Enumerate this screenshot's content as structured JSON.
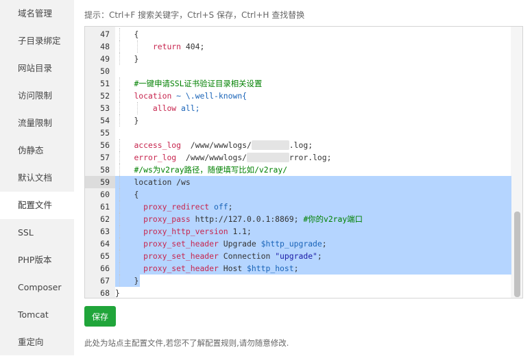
{
  "sidebar": {
    "items": [
      {
        "label": "域名管理"
      },
      {
        "label": "子目录绑定"
      },
      {
        "label": "网站目录"
      },
      {
        "label": "访问限制"
      },
      {
        "label": "流量限制"
      },
      {
        "label": "伪静态"
      },
      {
        "label": "默认文档"
      },
      {
        "label": "配置文件",
        "active": true
      },
      {
        "label": "SSL"
      },
      {
        "label": "PHP版本"
      },
      {
        "label": "Composer"
      },
      {
        "label": "Tomcat"
      },
      {
        "label": "重定向"
      }
    ]
  },
  "hint": "提示：Ctrl+F 搜索关键字，Ctrl+S 保存，Ctrl+H 查找替换",
  "editor": {
    "lines": [
      {
        "num": "47",
        "indent": 1,
        "tokens": [
          {
            "t": "{",
            "c": "txt"
          }
        ]
      },
      {
        "num": "48",
        "indent": 2,
        "tokens": [
          {
            "t": "return",
            "c": "key"
          },
          {
            "t": " 404;",
            "c": "txt"
          }
        ]
      },
      {
        "num": "49",
        "indent": 1,
        "tokens": [
          {
            "t": "}",
            "c": "txt"
          }
        ]
      },
      {
        "num": "50",
        "indent": 0,
        "tokens": []
      },
      {
        "num": "51",
        "indent": 1,
        "tokens": [
          {
            "t": "#一键申请SSL证书验证目录相关设置",
            "c": "com"
          }
        ]
      },
      {
        "num": "52",
        "indent": 1,
        "tokens": [
          {
            "t": "location",
            "c": "key"
          },
          {
            "t": " ~ \\.well-known{",
            "c": "var"
          }
        ]
      },
      {
        "num": "53",
        "indent": 2,
        "tokens": [
          {
            "t": "allow",
            "c": "key"
          },
          {
            "t": " all;",
            "c": "var"
          }
        ]
      },
      {
        "num": "54",
        "indent": 1,
        "tokens": [
          {
            "t": "}",
            "c": "txt"
          }
        ]
      },
      {
        "num": "55",
        "indent": 0,
        "tokens": []
      },
      {
        "num": "56",
        "indent": 1,
        "tokens": [
          {
            "t": "access_log",
            "c": "key"
          },
          {
            "t": "  /www/wwwlogs/",
            "c": "txt"
          },
          {
            "t": "        ",
            "c": "blur"
          },
          {
            "t": ".log;",
            "c": "txt"
          }
        ]
      },
      {
        "num": "57",
        "indent": 1,
        "tokens": [
          {
            "t": "error_log",
            "c": "key"
          },
          {
            "t": "  /www/wwwlogs/",
            "c": "txt"
          },
          {
            "t": "         ",
            "c": "blur"
          },
          {
            "t": "rror.log;",
            "c": "txt"
          }
        ]
      },
      {
        "num": "58",
        "indent": 1,
        "tokens": [
          {
            "t": "#/ws为v2ray路径，随便填写比如/v2ray/",
            "c": "com"
          }
        ]
      },
      {
        "num": "59",
        "indent": 1,
        "sel": true,
        "active": true,
        "tokens": [
          {
            "t": "location /ws",
            "c": "txt"
          }
        ]
      },
      {
        "num": "60",
        "indent": 1,
        "sel": true,
        "tokens": [
          {
            "t": "{",
            "c": "txt"
          }
        ]
      },
      {
        "num": "61",
        "indent": 1,
        "extra": "  ",
        "sel": true,
        "tokens": [
          {
            "t": "proxy_redirect",
            "c": "key"
          },
          {
            "t": " off",
            "c": "var"
          },
          {
            "t": ";",
            "c": "txt"
          }
        ]
      },
      {
        "num": "62",
        "indent": 1,
        "extra": "  ",
        "sel": true,
        "tokens": [
          {
            "t": "proxy_pass",
            "c": "key"
          },
          {
            "t": " http://127.0.0.1:8869; ",
            "c": "txt"
          },
          {
            "t": "#你的v2ray端口",
            "c": "com"
          }
        ]
      },
      {
        "num": "63",
        "indent": 1,
        "extra": "  ",
        "sel": true,
        "tokens": [
          {
            "t": "proxy_http_version",
            "c": "key"
          },
          {
            "t": " 1.1;",
            "c": "txt"
          }
        ]
      },
      {
        "num": "64",
        "indent": 1,
        "extra": "  ",
        "sel": true,
        "tokens": [
          {
            "t": "proxy_set_header",
            "c": "key"
          },
          {
            "t": " Upgrade ",
            "c": "txt"
          },
          {
            "t": "$http_upgrade",
            "c": "var"
          },
          {
            "t": ";",
            "c": "txt"
          }
        ]
      },
      {
        "num": "65",
        "indent": 1,
        "extra": "  ",
        "sel": true,
        "tokens": [
          {
            "t": "proxy_set_header",
            "c": "key"
          },
          {
            "t": " Connection ",
            "c": "txt"
          },
          {
            "t": "\"upgrade\"",
            "c": "str"
          },
          {
            "t": ";",
            "c": "txt"
          }
        ]
      },
      {
        "num": "66",
        "indent": 1,
        "extra": "  ",
        "sel": true,
        "tokens": [
          {
            "t": "proxy_set_header",
            "c": "key"
          },
          {
            "t": " Host ",
            "c": "txt"
          },
          {
            "t": "$http_host",
            "c": "var"
          },
          {
            "t": ";",
            "c": "txt"
          }
        ]
      },
      {
        "num": "67",
        "indent": 1,
        "sel": "partial",
        "tokens": [
          {
            "t": "}",
            "c": "txt"
          }
        ]
      },
      {
        "num": "68",
        "indent": 0,
        "tokens": [
          {
            "t": "}",
            "c": "txt"
          }
        ]
      }
    ]
  },
  "save_button": "保存",
  "footnote": "此处为站点主配置文件,若您不了解配置规则,请勿随意修改.",
  "colors": {
    "accent": "#20a53a",
    "selection": "#b5d5ff",
    "keyword": "#c7254e",
    "comment": "#008000"
  }
}
